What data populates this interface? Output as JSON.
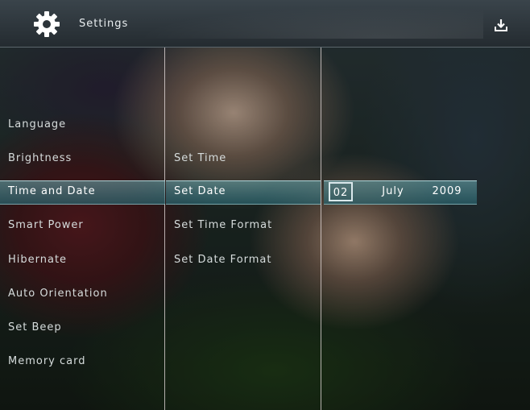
{
  "header": {
    "title": "Settings",
    "settings_icon": "gear-icon",
    "action_icon": "download-icon"
  },
  "menu": {
    "items": [
      "Language",
      "Brightness",
      "Time and Date",
      "Smart Power",
      "Hibernate",
      "Auto Orientation",
      "Set Beep",
      "Memory card"
    ],
    "selected": "Time and Date"
  },
  "submenu": {
    "items": [
      "Set Time",
      "Set Date",
      "Set Time Format",
      "Set Date Format"
    ],
    "selected": "Set Date"
  },
  "date_editor": {
    "day": "02",
    "month": "July",
    "year": "2009"
  },
  "colors": {
    "highlight": "#4a9aa5",
    "text": "#d6dcdc"
  }
}
